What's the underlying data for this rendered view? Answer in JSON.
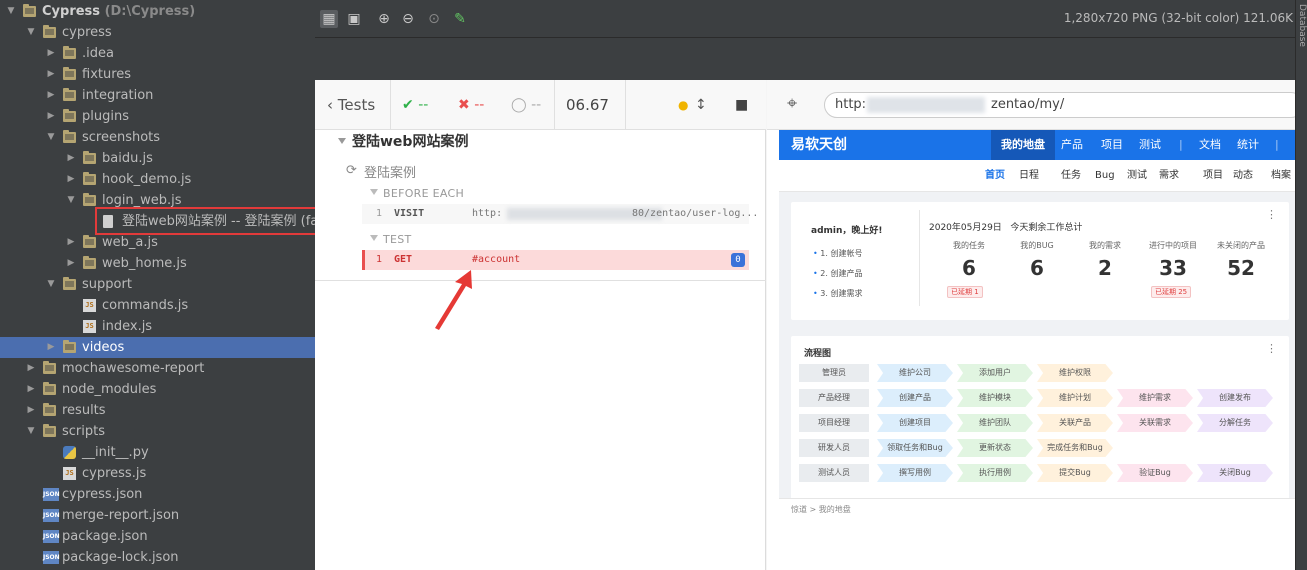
{
  "tree": [
    {
      "indent": 0,
      "arrow": "▼",
      "icon": "folder",
      "label": "Cypress",
      "path": "(D:\\Cypress)",
      "bold": true
    },
    {
      "indent": 1,
      "arrow": "▼",
      "icon": "folder",
      "label": "cypress"
    },
    {
      "indent": 2,
      "arrow": "▶",
      "icon": "folder",
      "label": ".idea"
    },
    {
      "indent": 2,
      "arrow": "▶",
      "icon": "folder",
      "label": "fixtures"
    },
    {
      "indent": 2,
      "arrow": "▶",
      "icon": "folder",
      "label": "integration"
    },
    {
      "indent": 2,
      "arrow": "▶",
      "icon": "folder",
      "label": "plugins"
    },
    {
      "indent": 2,
      "arrow": "▼",
      "icon": "folder",
      "label": "screenshots"
    },
    {
      "indent": 3,
      "arrow": "▶",
      "icon": "folder",
      "label": "baidu.js"
    },
    {
      "indent": 3,
      "arrow": "▶",
      "icon": "folder",
      "label": "hook_demo.js"
    },
    {
      "indent": 3,
      "arrow": "▼",
      "icon": "folder",
      "label": "login_web.js"
    },
    {
      "indent": 4,
      "arrow": "",
      "icon": "file",
      "label": "登陆web网站案例 -- 登陆案例 (faile"
    },
    {
      "indent": 3,
      "arrow": "▶",
      "icon": "folder",
      "label": "web_a.js"
    },
    {
      "indent": 3,
      "arrow": "▶",
      "icon": "folder",
      "label": "web_home.js"
    },
    {
      "indent": 2,
      "arrow": "▼",
      "icon": "folder",
      "label": "support"
    },
    {
      "indent": 3,
      "arrow": "",
      "icon": "js",
      "label": "commands.js"
    },
    {
      "indent": 3,
      "arrow": "",
      "icon": "js",
      "label": "index.js"
    },
    {
      "indent": 2,
      "arrow": "▶",
      "icon": "folder",
      "label": "videos",
      "selected": true
    },
    {
      "indent": 1,
      "arrow": "▶",
      "icon": "folder",
      "label": "mochawesome-report"
    },
    {
      "indent": 1,
      "arrow": "▶",
      "icon": "folder",
      "label": "node_modules"
    },
    {
      "indent": 1,
      "arrow": "▶",
      "icon": "folder",
      "label": "results"
    },
    {
      "indent": 1,
      "arrow": "▼",
      "icon": "folder",
      "label": "scripts"
    },
    {
      "indent": 2,
      "arrow": "",
      "icon": "py",
      "label": "__init__.py"
    },
    {
      "indent": 2,
      "arrow": "",
      "icon": "js",
      "label": "cypress.js"
    },
    {
      "indent": 1,
      "arrow": "",
      "icon": "json",
      "label": "cypress.json"
    },
    {
      "indent": 1,
      "arrow": "",
      "icon": "json",
      "label": "merge-report.json"
    },
    {
      "indent": 1,
      "arrow": "",
      "icon": "json",
      "label": "package.json"
    },
    {
      "indent": 1,
      "arrow": "",
      "icon": "json",
      "label": "package-lock.json"
    }
  ],
  "viewer": {
    "info": "1,280x720 PNG (32-bit color) 121.06K"
  },
  "gutter_label": "Database",
  "runner": {
    "tests_label": "Tests",
    "passed": "--",
    "failed": "--",
    "pending": "--",
    "duration": "06.67",
    "suite_title": "登陆web网站案例",
    "test_title": "登陆案例",
    "before_each_label": "BEFORE EACH",
    "test_label": "TEST",
    "visit": {
      "num": "1",
      "cmd": "VISIT",
      "msg": "http:",
      "msg_tail": "80/zentao/user-log..."
    },
    "get": {
      "num": "1",
      "cmd": "GET",
      "msg": "#account",
      "count": "0"
    }
  },
  "browser": {
    "url_prefix": "http:",
    "url_suffix": "zentao/my/"
  },
  "app": {
    "logo": "易软天创",
    "nav": [
      "我的地盘",
      "产品",
      "项目",
      "测试",
      "文档",
      "统计"
    ],
    "subnav": [
      "首页",
      "日程",
      "任务",
      "Bug",
      "测试",
      "需求",
      "项目",
      "动态",
      "档案"
    ],
    "greeting": "admin，晚上好!",
    "todo": [
      "1. 创建帐号",
      "2. 创建产品",
      "3. 创建需求"
    ],
    "date_label": "2020年05月29日",
    "summary_label": "今天剩余工作总计",
    "stats": [
      {
        "title": "我的任务",
        "value": "6",
        "badge": "已延期 1"
      },
      {
        "title": "我的BUG",
        "value": "6",
        "badge": ""
      },
      {
        "title": "我的需求",
        "value": "2",
        "badge": ""
      },
      {
        "title": "进行中的项目",
        "value": "33",
        "badge": "已延期 25"
      },
      {
        "title": "未关闭的产品",
        "value": "52",
        "badge": ""
      }
    ],
    "flow_title": "流程图",
    "flow": [
      {
        "role": "管理员",
        "steps": [
          "维护公司",
          "添加用户",
          "维护权限"
        ]
      },
      {
        "role": "产品经理",
        "steps": [
          "创建产品",
          "维护模块",
          "维护计划",
          "维护需求",
          "创建发布"
        ]
      },
      {
        "role": "项目经理",
        "steps": [
          "创建项目",
          "维护团队",
          "关联产品",
          "关联需求",
          "分解任务"
        ]
      },
      {
        "role": "研发人员",
        "steps": [
          "领取任务和Bug",
          "更新状态",
          "完成任务和Bug"
        ]
      },
      {
        "role": "测试人员",
        "steps": [
          "撰写用例",
          "执行用例",
          "提交Bug",
          "验证Bug",
          "关闭Bug"
        ]
      }
    ],
    "breadcrumb": "惊道 > 我的地盘"
  }
}
